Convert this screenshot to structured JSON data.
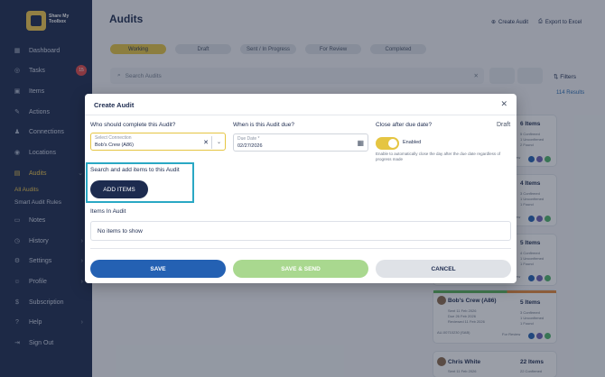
{
  "brand": {
    "logo_text": "Share My Toolbox"
  },
  "sidebar": {
    "items": [
      {
        "label": "Dashboard",
        "icon": "grid-icon"
      },
      {
        "label": "Tasks",
        "icon": "check-circle-icon",
        "badge": "15"
      },
      {
        "label": "Items",
        "icon": "box-icon"
      },
      {
        "label": "Actions",
        "icon": "edit-icon"
      },
      {
        "label": "Connections",
        "icon": "person-icon"
      },
      {
        "label": "Locations",
        "icon": "location-icon"
      },
      {
        "label": "Audits",
        "icon": "clipboard-icon"
      },
      {
        "label": "Notes",
        "icon": "note-icon"
      },
      {
        "label": "History",
        "icon": "history-icon"
      },
      {
        "label": "Settings",
        "icon": "gear-icon"
      },
      {
        "label": "Profile",
        "icon": "profile-icon"
      },
      {
        "label": "Subscription",
        "icon": "money-icon"
      },
      {
        "label": "Help",
        "icon": "help-icon"
      },
      {
        "label": "Sign Out",
        "icon": "signout-icon"
      }
    ],
    "sub_items": [
      {
        "label": "All Audits"
      },
      {
        "label": "Smart Audit Rules"
      }
    ]
  },
  "header": {
    "title": "Audits",
    "create_label": "Create Audit",
    "export_label": "Export to Excel"
  },
  "tabs": [
    "Working",
    "Draft",
    "Sent / In Progress",
    "For Review",
    "Completed"
  ],
  "search": {
    "placeholder": "Search Audits"
  },
  "filters_label": "Filters",
  "results_label": "114 Results",
  "cards": [
    {
      "title": "6 Items",
      "lines": [
        "5 Confirmed",
        "1 Unconfirmed",
        "2 Found"
      ],
      "tag": "For Review"
    },
    {
      "title": "4 Items",
      "lines": [
        "3 Confirmed",
        "1 Unconfirmed",
        "1 Found"
      ],
      "tag": "For Review"
    },
    {
      "title": "5 Items",
      "lines": [
        "4 Confirmed",
        "1 Unconfirmed",
        "1 Found"
      ],
      "tag": "For Review"
    },
    {
      "name": "Bob's Crew (A86)",
      "meta": [
        "Sent 11 Feb 2026",
        "Due 26 Feb 2026",
        "Reviewed 11 Feb 2026"
      ],
      "code": "AU-00710230 (SAB)",
      "title": "5 Items",
      "lines": [
        "3 Confirmed",
        "1 Unconfirmed",
        "1 Found"
      ],
      "tag": "For Review"
    },
    {
      "name": "Chris White",
      "meta": [
        "Sent 11 Feb 2026"
      ],
      "title": "22 Items",
      "lines": [
        "22 Confirmed"
      ]
    }
  ],
  "modal": {
    "title": "Create Audit",
    "who_label": "Who should complete this Audit?",
    "connection_field_label": "Select Connection",
    "connection_value": "Bob's Crew (A86)",
    "due_label": "When is this Audit due?",
    "due_field_label": "Due Date *",
    "due_value": "02/27/2026",
    "close_label": "Close after due date?",
    "status": "Draft",
    "toggle_label": "Enabled",
    "toggle_help": "Enable to automatically close the day after the due date regardless of progress made",
    "search_label": "Search and add items to this Audit",
    "add_items": "ADD ITEMS",
    "items_label": "Items In Audit",
    "empty_items": "No items to show",
    "save": "SAVE",
    "save_send": "SAVE & SEND",
    "cancel": "CANCEL"
  },
  "colors": {
    "sidebar_bg": "#1d2b4f",
    "accent": "#e5c542",
    "primary": "#2461b3",
    "highlight": "#2aa8c4",
    "success_light": "#a9d88f"
  }
}
